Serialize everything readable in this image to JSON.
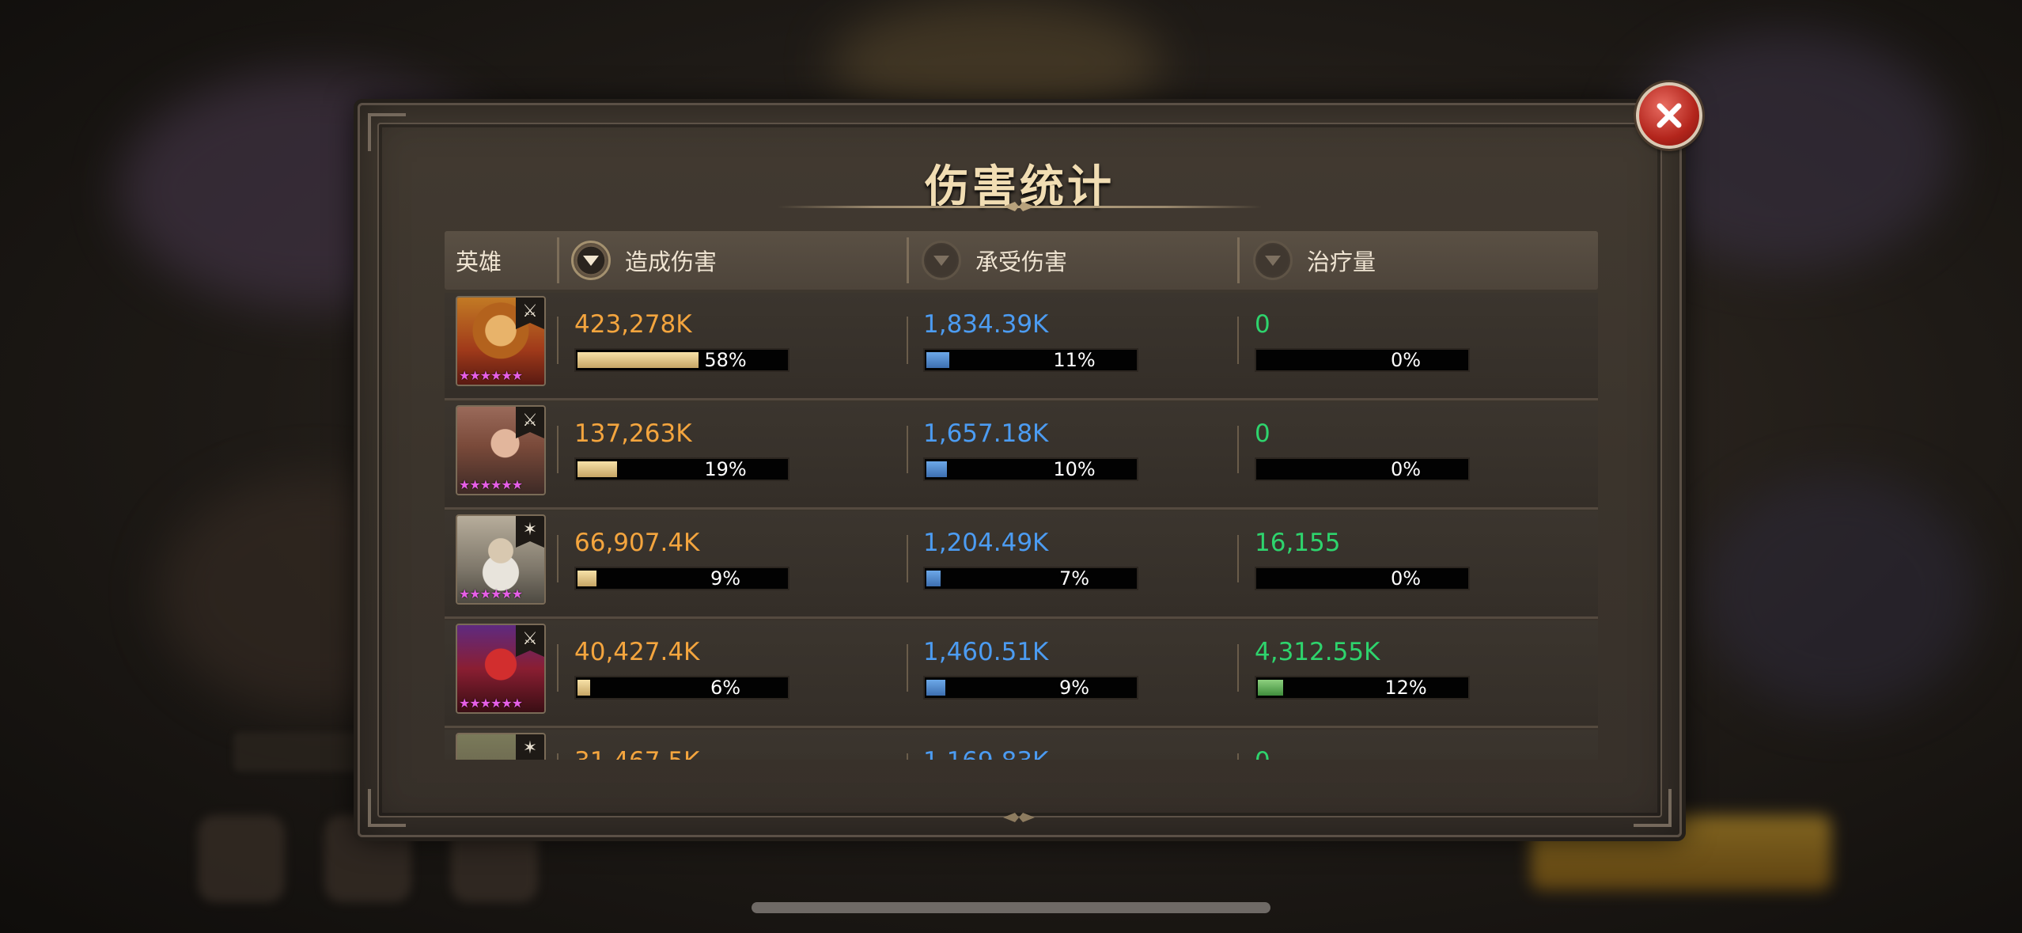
{
  "title": "伤害统计",
  "headers": {
    "hero": "英雄",
    "damage_dealt": "造成伤害",
    "damage_taken": "承受伤害",
    "healing": "治疗量"
  },
  "sort": {
    "active_column": "damage_dealt",
    "icon": "chevron-down-icon"
  },
  "colors": {
    "damage": "#f4a53e",
    "taken": "#4c9cf2",
    "heal": "#2ed46d",
    "stars": "#e65fe6"
  },
  "rows": [
    {
      "hero_icon": "monkey-king-portrait",
      "class_icon": "sword-icon",
      "stars": "★★★★★★",
      "dealt": "423,278K",
      "dealt_pct": "58%",
      "dealt_frac": 0.58,
      "taken": "1,834.39K",
      "taken_pct": "11%",
      "taken_frac": 0.11,
      "heal": "0",
      "heal_pct": "0%",
      "heal_frac": 0
    },
    {
      "hero_icon": "elf-warrior-portrait",
      "class_icon": "sword-icon",
      "stars": "★★★★★★",
      "dealt": "137,263K",
      "dealt_pct": "19%",
      "dealt_frac": 0.19,
      "taken": "1,657.18K",
      "taken_pct": "10%",
      "taken_frac": 0.1,
      "heal": "0",
      "heal_pct": "0%",
      "heal_frac": 0
    },
    {
      "hero_icon": "old-wizard-portrait",
      "class_icon": "staff-icon",
      "stars": "★★★★★★",
      "dealt": "66,907.4K",
      "dealt_pct": "9%",
      "dealt_frac": 0.09,
      "taken": "1,204.49K",
      "taken_pct": "7%",
      "taken_frac": 0.07,
      "heal": "16,155",
      "heal_pct": "0%",
      "heal_frac": 0
    },
    {
      "hero_icon": "red-demon-portrait",
      "class_icon": "sword-icon",
      "stars": "★★★★★★",
      "dealt": "40,427.4K",
      "dealt_pct": "6%",
      "dealt_frac": 0.06,
      "taken": "1,460.51K",
      "taken_pct": "9%",
      "taken_frac": 0.09,
      "heal": "4,312.55K",
      "heal_pct": "12%",
      "heal_frac": 0.12
    },
    {
      "hero_icon": "hooded-hero-portrait",
      "class_icon": "staff-icon",
      "stars": "★★★★★★",
      "dealt": "31,467.5K",
      "dealt_pct": "",
      "dealt_frac": 0.04,
      "taken": "1,169.83K",
      "taken_pct": "",
      "taken_frac": 0.06,
      "heal": "0",
      "heal_pct": "",
      "heal_frac": 0
    }
  ]
}
